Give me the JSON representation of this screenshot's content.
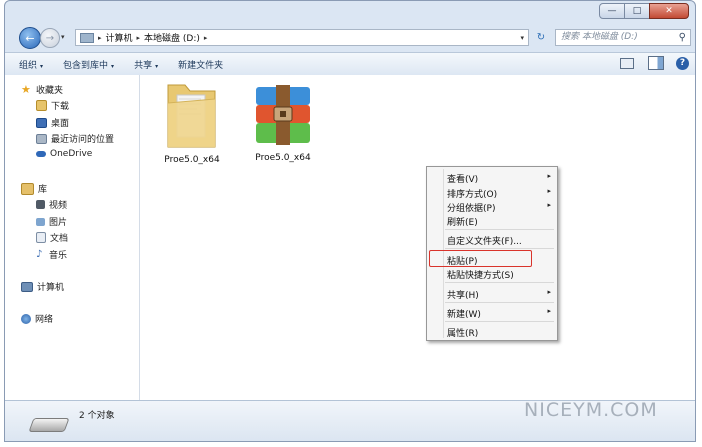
{
  "window": {
    "controls": {
      "minimize": "—",
      "maximize": "□",
      "close": "✕"
    }
  },
  "navigation": {
    "back": "←",
    "forward": "→",
    "breadcrumb": [
      "计算机",
      "本地磁盘 (D:)"
    ],
    "search_placeholder": "搜索 本地磁盘 (D:)"
  },
  "toolbar": {
    "organize": "组织",
    "include_in_library": "包含到库中",
    "share": "共享",
    "new_folder": "新建文件夹"
  },
  "sidebar": {
    "favorites": "收藏夹",
    "downloads": "下载",
    "desktop": "桌面",
    "recent_places": "最近访问的位置",
    "onedrive": "OneDrive",
    "libraries": "库",
    "videos": "视频",
    "pictures": "图片",
    "documents": "文档",
    "music": "音乐",
    "computer": "计算机",
    "network": "网络"
  },
  "files": [
    {
      "name": "Proe5.0_x64",
      "type": "folder"
    },
    {
      "name": "Proe5.0_x64",
      "type": "rar-archive"
    }
  ],
  "status": {
    "count": "2 个对象"
  },
  "context_menu": {
    "view": "查看(V)",
    "sort_by": "排序方式(O)",
    "group_by": "分组依据(P)",
    "refresh": "刷新(E)",
    "customize": "自定义文件夹(F)...",
    "paste": "粘贴(P)",
    "paste_shortcut": "粘贴快捷方式(S)",
    "share_with": "共享(H)",
    "new": "新建(W)",
    "properties": "属性(R)",
    "highlighted_item": "粘贴(P)"
  },
  "watermark": "NICEYM.COM"
}
